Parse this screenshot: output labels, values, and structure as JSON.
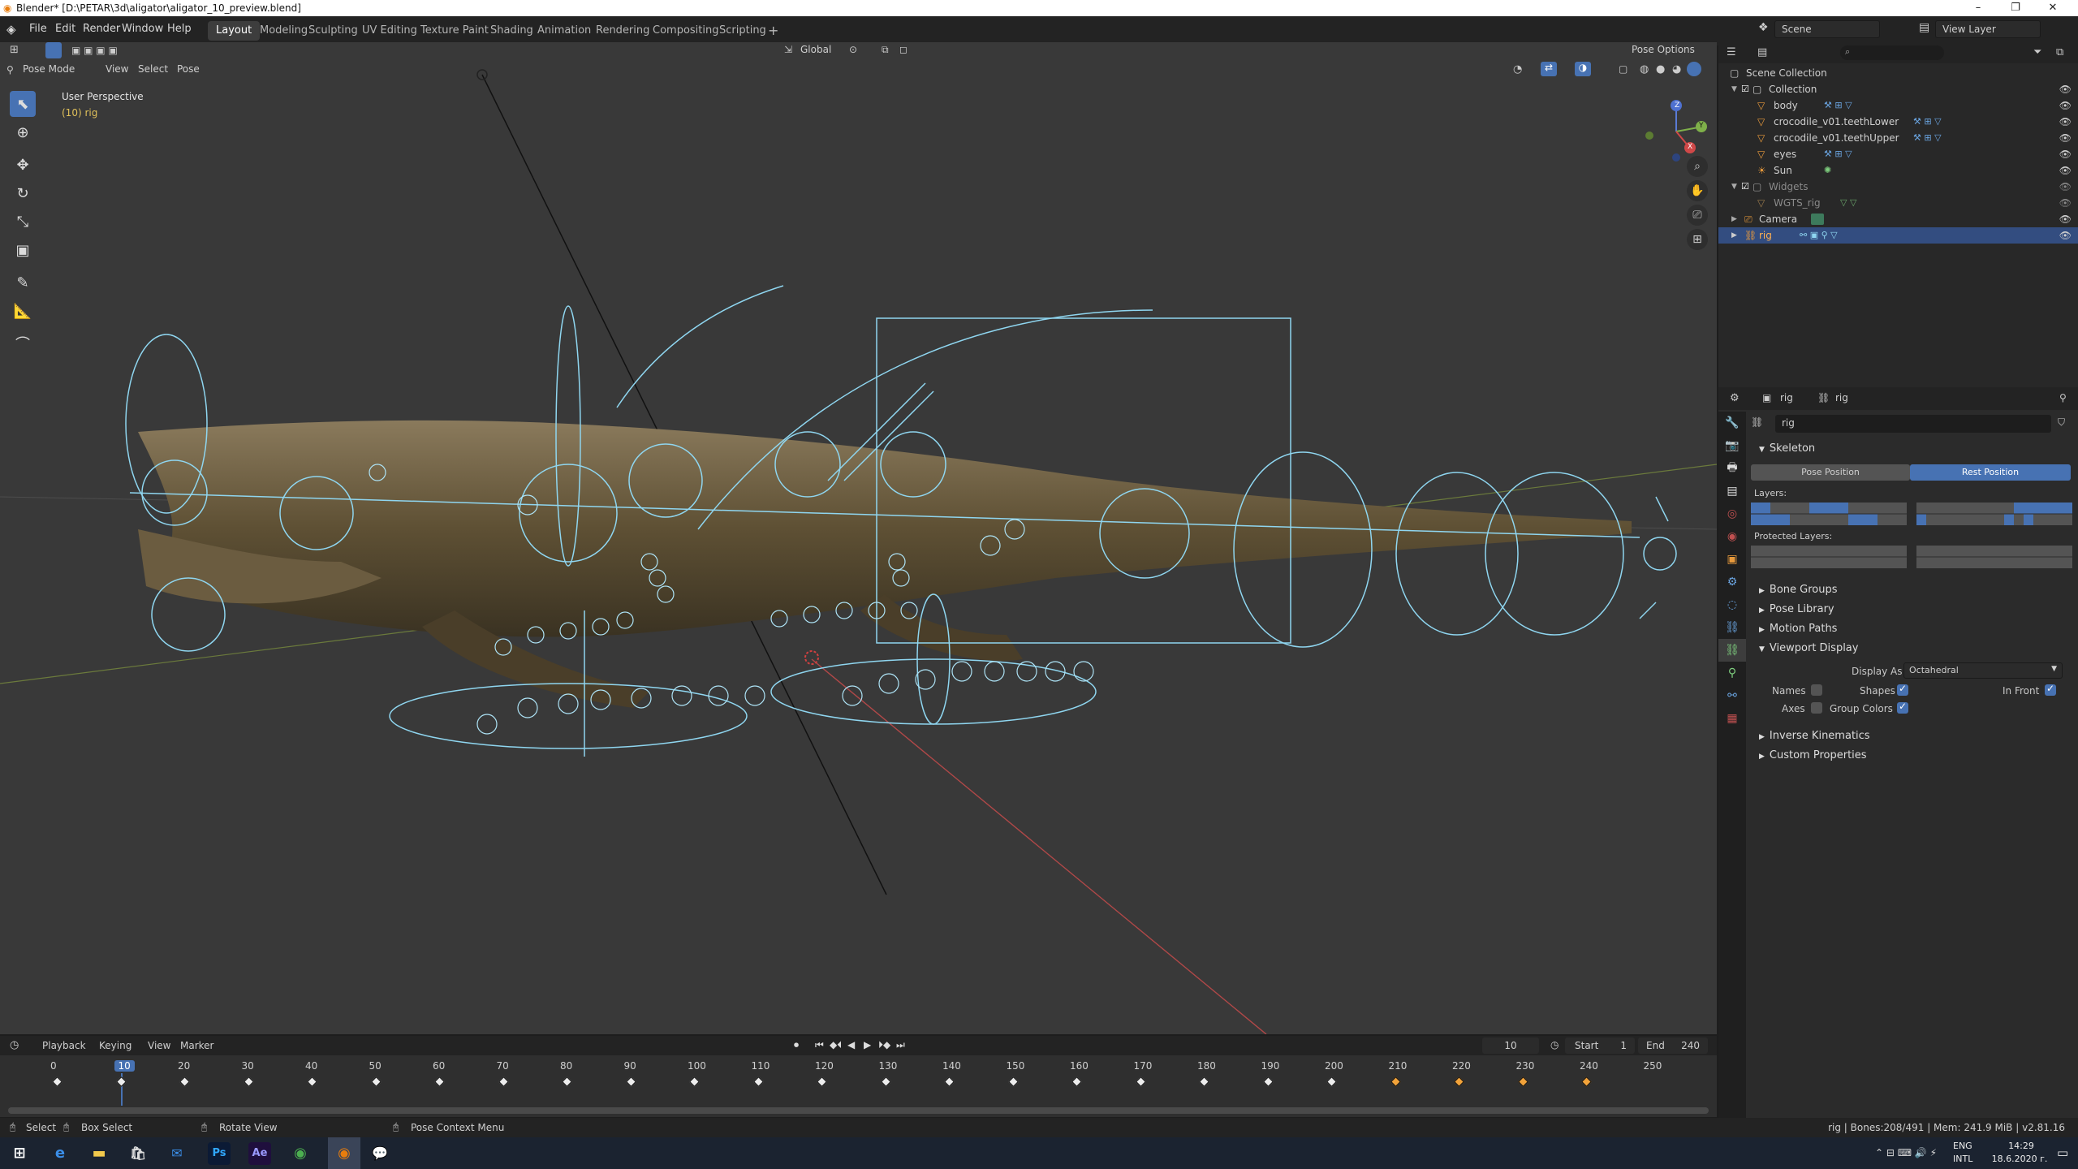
{
  "window": {
    "title": "Blender* [D:\\PETAR\\3d\\aligator\\aligator_10_preview.blend]"
  },
  "menu": [
    "File",
    "Edit",
    "Render",
    "Window",
    "Help"
  ],
  "workspaces": [
    "Layout",
    "Modeling",
    "Sculpting",
    "UV Editing",
    "Texture Paint",
    "Shading",
    "Animation",
    "Rendering",
    "Compositing",
    "Scripting"
  ],
  "active_workspace": "Layout",
  "scene": {
    "name": "Scene",
    "view_layer": "View Layer"
  },
  "viewport": {
    "mode": "Pose Mode",
    "menus": [
      "View",
      "Select",
      "Pose"
    ],
    "orientation": "Global",
    "pose_options": "Pose Options",
    "overlay_title": "User Perspective",
    "overlay_sub": "(10) rig",
    "gizmo": {
      "x": "X",
      "y": "Y",
      "z": "Z"
    }
  },
  "outliner": {
    "root": "Scene Collection",
    "items": [
      {
        "label": "Collection",
        "indent": 1
      },
      {
        "label": "body",
        "indent": 2
      },
      {
        "label": "crocodile_v01.teethLower",
        "indent": 2
      },
      {
        "label": "crocodile_v01.teethUpper",
        "indent": 2
      },
      {
        "label": "eyes",
        "indent": 2
      },
      {
        "label": "Sun",
        "indent": 2
      },
      {
        "label": "Widgets",
        "indent": 1
      },
      {
        "label": "WGTS_rig",
        "indent": 2
      },
      {
        "label": "Camera",
        "indent": 1
      },
      {
        "label": "rig",
        "indent": 1
      }
    ],
    "selected": "rig"
  },
  "properties": {
    "object": "rig",
    "data": "rig",
    "data_field": "rig",
    "skeleton": {
      "title": "Skeleton",
      "pose_position": "Pose Position",
      "rest_position": "Rest Position",
      "layers_label": "Layers:",
      "protected_label": "Protected Layers:"
    },
    "panels": [
      "Bone Groups",
      "Pose Library",
      "Motion Paths"
    ],
    "viewport_display": {
      "title": "Viewport Display",
      "display_as_label": "Display As",
      "display_as_value": "Octahedral",
      "names": "Names",
      "shapes": "Shapes",
      "in_front": "In Front",
      "axes": "Axes",
      "group_colors": "Group Colors"
    },
    "panels_after": [
      "Inverse Kinematics",
      "Custom Properties"
    ]
  },
  "timeline": {
    "menus": [
      "Playback",
      "Keying",
      "View",
      "Marker"
    ],
    "current_frame": "10",
    "start_label": "Start",
    "start": "1",
    "end_label": "End",
    "end": "240",
    "ticks": [
      "0",
      "10",
      "20",
      "30",
      "40",
      "50",
      "60",
      "70",
      "80",
      "90",
      "100",
      "110",
      "120",
      "130",
      "140",
      "150",
      "160",
      "170",
      "180",
      "190",
      "200",
      "210",
      "220",
      "230",
      "240",
      "250"
    ],
    "keyframes": [
      0,
      10,
      20,
      30,
      40,
      50,
      60,
      70,
      80,
      90,
      100,
      110,
      120,
      130,
      140,
      150,
      160,
      170,
      180,
      190,
      200,
      210,
      220,
      230,
      240
    ],
    "orange_keyframes": [
      210,
      220,
      230,
      240
    ]
  },
  "statusbar": {
    "select": "Select",
    "box_select": "Box Select",
    "rotate": "Rotate View",
    "context": "Pose Context Menu",
    "stats": "rig | Bones:208/491 | Mem: 241.9 MiB | v2.81.16"
  },
  "taskbar": {
    "lang": "ENG",
    "layout": "INTL",
    "time": "14:29",
    "date": "18.6.2020 г."
  }
}
